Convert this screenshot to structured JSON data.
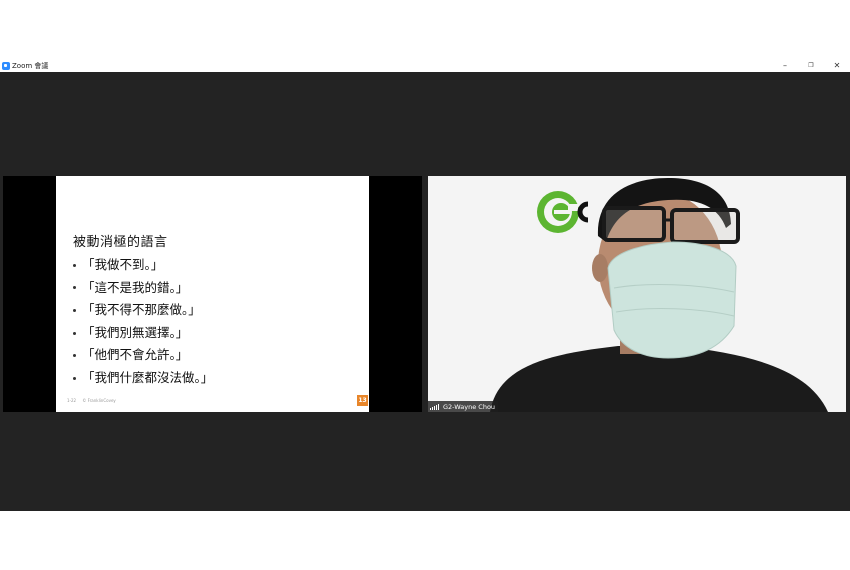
{
  "window": {
    "title": "Zoom 會議"
  },
  "titlebar_controls": {
    "minimize": "–",
    "restore": "❐",
    "close": "✕"
  },
  "shared_screen": {
    "slide_title": "被動消極的語言",
    "bullets": [
      "「我做不到。」",
      "「這不是我的錯。」",
      "「我不得不那麼做。」",
      "「我們別無選擇。」",
      "「他們不會允許。」",
      "「我們什麼都沒法做。」"
    ],
    "footer_left": "1-22",
    "footer_right": "© FranklinCovey",
    "page_number": "13"
  },
  "video": {
    "participant_name": "G2-Wayne Chou"
  },
  "colors": {
    "meeting_bg": "#232323",
    "logo_green": "#5cb531",
    "mask": "#cde4dd",
    "page_badge": "#e8862a"
  }
}
